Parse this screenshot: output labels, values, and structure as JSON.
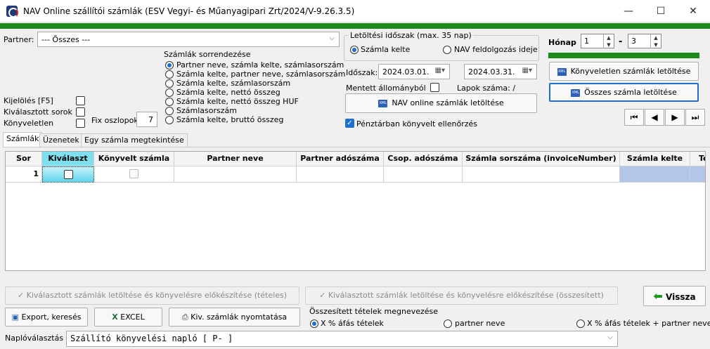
{
  "window": {
    "title": "NAV Online szállítói számlák (ESV Vegyi- és Műanyagipari Zrt/2024/V-9.26.3.5)",
    "min_label": "—",
    "max_label": "☐",
    "close_label": "✕"
  },
  "partner": {
    "label": "Partner:",
    "value": "--- Összes ---"
  },
  "sort": {
    "title": "Számlák sorrendezése",
    "options": [
      "Partner neve, számla kelte, számlasorszám",
      "Számla kelte, partner neve, számlasorszám",
      "Számla kelte, számlasorszám",
      "Számla kelte, nettó összeg",
      "Számla kelte, nettó összeg HUF",
      "Számlasorszám",
      "Számla kelte, bruttó összeg"
    ],
    "selected": 0
  },
  "left_checks": {
    "kijeloles": "Kijelölés [F5]",
    "kivalasztott_sorok": "Kiválasztott sorok",
    "konyveletlen": "Könyveletlen",
    "fix_oszlopok_label": "Fix oszlopok",
    "fix_oszlopok_value": "7"
  },
  "download_period": {
    "title": "Letöltési időszak (max. 35 nap)",
    "radio_szamla_kelte": "Számla kelte",
    "radio_nav": "NAV feldolgozás ideje",
    "idoszak_label": "Időszak:",
    "date_from": "2024.03.01.",
    "date_to": "2024.03.31.",
    "mentett_label": "Mentett állományból",
    "lapok_label": "Lapok száma: /",
    "nav_button": "NAV online számlák letöltése",
    "penztar_label": "Pénztárban könyvelt ellenőrzés",
    "xml_badge": "XML"
  },
  "month": {
    "label": "Hónap",
    "from": "1",
    "dash": "-",
    "to": "3",
    "up": "▲",
    "down": "▼"
  },
  "right_buttons": {
    "konyveletlen": "Könyveletlen számlák letöltése",
    "osszes": "Összes számla letöltése"
  },
  "nav": {
    "first": "⏮",
    "prev": "◀",
    "next": "▶",
    "last": "⏭"
  },
  "tabs": [
    "Számlák",
    "Üzenetek",
    "Egy számla megtekintése"
  ],
  "grid": {
    "columns": [
      "Sor",
      "Kiválaszt",
      "Könyvelt számla",
      "Partner neve",
      "Partner adószáma",
      "Csop. adószáma",
      "Számla sorszáma (invoiceNumber)",
      "Számla kelte",
      "Te"
    ],
    "rows": [
      {
        "sor": "1"
      }
    ]
  },
  "bottom": {
    "btn_teteles": "Kiválasztott számlák letöltése és könyvelésre előkészítése (tételes)",
    "btn_osszesitett": "Kiválasztott számlák letöltése és könyvelésre előkészítése (összesített)",
    "btn_vissza": "Vissza",
    "btn_export": "Export, keresés",
    "btn_excel": "EXCEL",
    "btn_print": "Kiv. számlák nyomtatása",
    "osszesitett_title": "Összesített tételek megnevezése",
    "radio_afas": "X % áfás tételek",
    "radio_partner": "partner neve",
    "radio_afas_partner": "X % áfás tételek + partner neve",
    "naplo_label": "Naplóválasztás",
    "naplo_value": "Szállító könyvelési napló [ P- ]"
  },
  "colors": {
    "accent_green": "#1a8a1a",
    "selection_blue": "#1f6fd0",
    "grid_highlight": "#b4c6e7"
  }
}
